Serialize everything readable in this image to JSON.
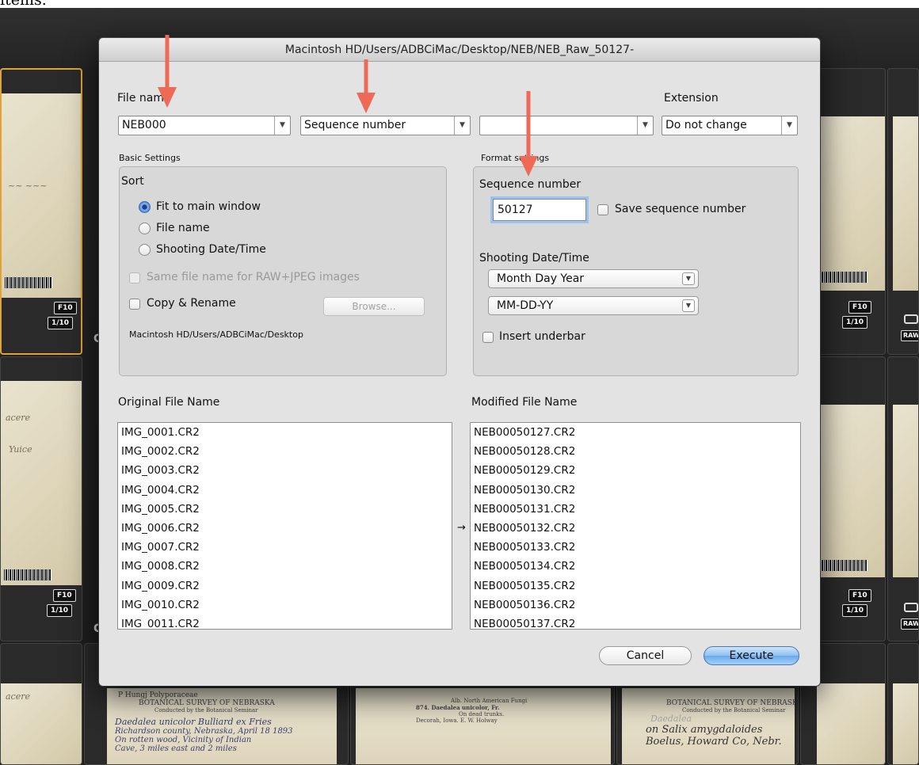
{
  "top_strip_text": "items.",
  "dialog": {
    "title": "Macintosh HD/Users/ADBCiMac/Desktop/NEB/NEB_Raw_50127-",
    "file_name_label": "File name",
    "extension_label": "Extension",
    "combo1_value": "NEB000",
    "combo2_value": "Sequence number",
    "combo3_value": "",
    "extension_value": "Do not change",
    "basic_settings_label": "Basic Settings",
    "sort_label": "Sort",
    "sort_options": [
      "Fit to main window",
      "File name",
      "Shooting Date/Time"
    ],
    "sort_selected_index": 0,
    "same_file_name_label": "Same file name for RAW+JPEG images",
    "copy_rename_label": "Copy & Rename",
    "browse_label": "Browse...",
    "copy_path": "Macintosh HD/Users/ADBCiMac/Desktop",
    "format_settings_label": "Format settings",
    "sequence_number_label": "Sequence number",
    "sequence_number_value": "50127",
    "save_sequence_label": "Save sequence number",
    "shooting_date_label": "Shooting Date/Time",
    "date_order_value": "Month Day Year",
    "date_format_value": "MM-DD-YY",
    "insert_underbar_label": "Insert underbar",
    "original_header": "Original File Name",
    "modified_header": "Modified File Name",
    "original_files": [
      "IMG_0001.CR2",
      "IMG_0002.CR2",
      "IMG_0003.CR2",
      "IMG_0004.CR2",
      "IMG_0005.CR2",
      "IMG_0006.CR2",
      "IMG_0007.CR2",
      "IMG_0008.CR2",
      "IMG_0009.CR2",
      "IMG_0010.CR2",
      "IMG_0011.CR2"
    ],
    "modified_files": [
      "NEB00050127.CR2",
      "NEB00050128.CR2",
      "NEB00050129.CR2",
      "NEB00050130.CR2",
      "NEB00050131.CR2",
      "NEB00050132.CR2",
      "NEB00050133.CR2",
      "NEB00050134.CR2",
      "NEB00050135.CR2",
      "NEB00050136.CR2",
      "NEB00050137.CR2"
    ],
    "arrow_marker": "→",
    "cancel_label": "Cancel",
    "execute_label": "Execute"
  },
  "thumbnails": {
    "tag_f10": "F10",
    "tag_1_10": "1/10",
    "tag_raw": "RAW",
    "letter_c": "C"
  },
  "bottom_thumbs": {
    "thumb2_lines": [
      "P Hungj   Polyporaceae",
      "BOTANICAL SURVEY OF NEBRASKA",
      "Conducted by the Botanical Seminar"
    ],
    "thumb2_hand": [
      "Daedalea unicolor Bulliard ex Fries",
      "Richardson county, Nebraska, April 18 1893",
      "On rotten wood, Vicinity of Indian",
      "Cave, 3 miles east and 2 miles"
    ],
    "thumb3_lines": [
      "Alb. North American Fungi",
      "874. Daedalea unicolor, Fr.",
      "On dead trunks.",
      "Decorah, Iowa.    E. W. Holway"
    ],
    "thumb4_lines": [
      "BOTANICAL SURVEY OF NEBRASKA",
      "Conducted by the Botanical Seminar"
    ],
    "thumb4_hand": [
      "Daedalea",
      "on Salix amygdaloides",
      "Boelus, Howard Co, Nebr."
    ]
  },
  "colors": {
    "selection_border": "#e0a33a",
    "annotation_arrow": "#ef6a56",
    "default_button": "#6aa9ea"
  }
}
